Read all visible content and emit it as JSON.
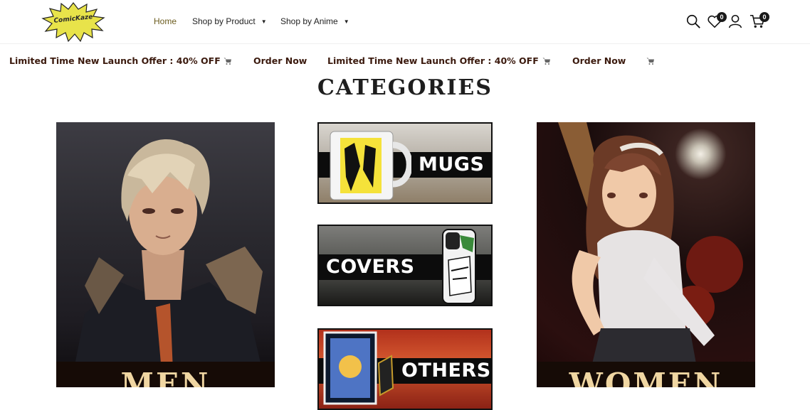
{
  "header": {
    "logo_text": "ComicKaze",
    "nav": {
      "home": "Home",
      "shop_by_product": "Shop by Product",
      "shop_by_anime": "Shop by Anime"
    },
    "wishlist_count": "0",
    "cart_count": "0",
    "icons": [
      "search-icon",
      "heart-icon",
      "user-icon",
      "cart-icon"
    ]
  },
  "ticker": {
    "offer_1": "Limited Time New Launch Offer : 40% OFF",
    "order_1": "Order Now",
    "offer_2": "Limited Time New Launch Offer : 40% OFF",
    "order_2": "Order Now"
  },
  "categories": {
    "title": "CATEGORIES",
    "men": "MEN",
    "women": "WOMEN",
    "mugs": "MUGS",
    "covers": "COVERS",
    "others": "OTHERS"
  },
  "colors": {
    "nav_active": "#6b5b1d",
    "ticker_text": "#3b1a0e",
    "card_label": "#f0d6a2",
    "logo_burst": "#e8e34a"
  }
}
